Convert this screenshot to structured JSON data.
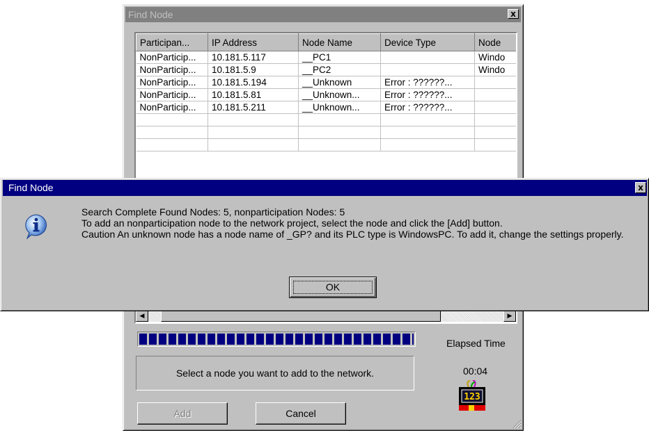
{
  "background_window": {
    "title": "Find Node",
    "close_glyph": "x",
    "table": {
      "columns": [
        "Participan...",
        "IP Address",
        "Node Name",
        "Device Type",
        "Node"
      ],
      "rows": [
        [
          "NonParticip...",
          "10.181.5.117",
          "__PC1",
          "",
          "Windo"
        ],
        [
          "NonParticip...",
          "10.181.5.9",
          "__PC2",
          "",
          "Windo"
        ],
        [
          "NonParticip...",
          "10.181.5.194",
          "__Unknown",
          "Error : ??????...",
          ""
        ],
        [
          "NonParticip...",
          "10.181.5.81",
          "__Unknown...",
          "Error : ??????...",
          ""
        ],
        [
          "NonParticip...",
          "10.181.5.211",
          "__Unknown...",
          "Error : ??????...",
          ""
        ]
      ],
      "empty_row_count": 3
    },
    "progress_fraction": 1.0,
    "elapsed_label": "Elapsed Time",
    "elapsed_value": "00:04",
    "message": "Select a node you want to add to the network.",
    "buttons": {
      "add": "Add",
      "cancel": "Cancel"
    },
    "timer_display": "123"
  },
  "dialog": {
    "title": "Find Node",
    "icon": "info-icon",
    "message": "Search Complete Found Nodes: 5, nonparticipation Nodes: 5\nTo add an nonparticipation node to the network project, select the node and click the [Add] button.\nCaution An unknown node has a node name of _GP? and its PLC type is WindowsPC. To add it, change the settings properly.",
    "ok_label": "OK",
    "close_glyph": "x"
  },
  "colors": {
    "title_active": "#000080",
    "title_inactive": "#808080",
    "face": "#c0c0c0",
    "progress": "#000080"
  }
}
